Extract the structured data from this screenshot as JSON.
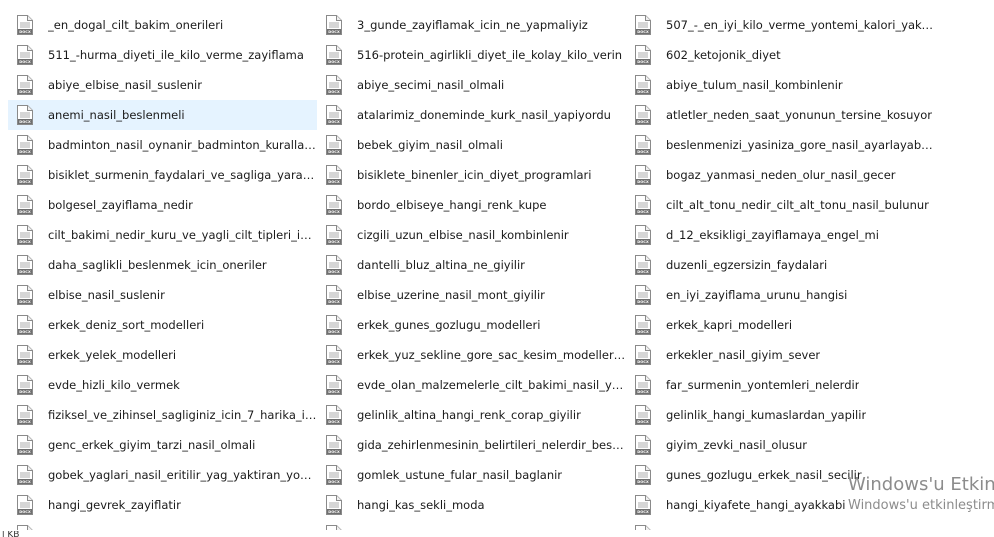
{
  "columns": [
    {
      "items": [
        {
          "name": "_en_dogal_cilt_bakim_onerileri",
          "icon": "docx-file-icon"
        },
        {
          "name": "511_-hurma_diyeti_ile_kilo_verme_zayiflama",
          "icon": "docx-file-icon"
        },
        {
          "name": "abiye_elbise_nasil_suslenir",
          "icon": "docx-file-icon"
        },
        {
          "name": "anemi_nasil_beslenmeli",
          "icon": "docx-file-icon",
          "selected": true
        },
        {
          "name": "badminton_nasil_oynanir_badminton_kurallari...",
          "icon": "docx-file-icon"
        },
        {
          "name": "bisiklet_surmenin_faydalari_ve_sagliga_yararlar...",
          "icon": "docx-file-icon"
        },
        {
          "name": "bolgesel_zayiflama_nedir",
          "icon": "docx-file-icon"
        },
        {
          "name": "cilt_bakimi_nedir_kuru_ve_yagli_cilt_tipleri_icin...",
          "icon": "docx-file-icon"
        },
        {
          "name": "daha_saglikli_beslenmek_icin_oneriler",
          "icon": "docx-file-icon"
        },
        {
          "name": "elbise_nasil_suslenir",
          "icon": "docx-file-icon"
        },
        {
          "name": "erkek_deniz_sort_modelleri",
          "icon": "docx-file-icon"
        },
        {
          "name": "erkek_yelek_modelleri",
          "icon": "docx-file-icon"
        },
        {
          "name": "evde_hizli_kilo_vermek",
          "icon": "docx-file-icon"
        },
        {
          "name": "fiziksel_ve_zihinsel_sagliginiz_icin_7_harika_ipu...",
          "icon": "docx-file-icon"
        },
        {
          "name": "genc_erkek_giyim_tarzi_nasil_olmali",
          "icon": "docx-file-icon"
        },
        {
          "name": "gobek_yaglari_nasil_eritilir_yag_yaktiran_yonte...",
          "icon": "docx-file-icon"
        },
        {
          "name": "hangi_gevrek_zayiflatir",
          "icon": "docx-file-icon"
        },
        {
          "name": "",
          "icon": "docx-file-icon"
        }
      ]
    },
    {
      "items": [
        {
          "name": "3_gunde_zayiflamak_icin_ne_yapmaliyiz",
          "icon": "docx-file-icon"
        },
        {
          "name": "516-protein_agirlikli_diyet_ile_kolay_kilo_verin",
          "icon": "docx-file-icon"
        },
        {
          "name": "abiye_secimi_nasil_olmali",
          "icon": "docx-file-icon"
        },
        {
          "name": "atalarimiz_doneminde_kurk_nasil_yapiyordu",
          "icon": "docx-file-icon"
        },
        {
          "name": "bebek_giyim_nasil_olmali",
          "icon": "docx-file-icon"
        },
        {
          "name": "bisiklete_binenler_icin_diyet_programlari",
          "icon": "docx-file-icon"
        },
        {
          "name": "bordo_elbiseye_hangi_renk_kupe",
          "icon": "docx-file-icon"
        },
        {
          "name": "cizgili_uzun_elbise_nasil_kombinlenir",
          "icon": "docx-file-icon"
        },
        {
          "name": "dantelli_bluz_altina_ne_giyilir",
          "icon": "docx-file-icon"
        },
        {
          "name": "elbise_uzerine_nasil_mont_giyilir",
          "icon": "docx-file-icon"
        },
        {
          "name": "erkek_gunes_gozlugu_modelleri",
          "icon": "docx-file-icon"
        },
        {
          "name": "erkek_yuz_sekline_gore_sac_kesim_modelleri_n...",
          "icon": "docx-file-icon"
        },
        {
          "name": "evde_olan_malzemelerle_cilt_bakimi_nasil_yapilir",
          "icon": "docx-file-icon"
        },
        {
          "name": "gelinlik_altina_hangi_renk_corap_giyilir",
          "icon": "docx-file-icon"
        },
        {
          "name": "gida_zehirlenmesinin_belirtileri_nelerdir_besin_...",
          "icon": "docx-file-icon"
        },
        {
          "name": "gomlek_ustune_fular_nasil_baglanir",
          "icon": "docx-file-icon"
        },
        {
          "name": "hangi_kas_sekli_moda",
          "icon": "docx-file-icon"
        },
        {
          "name": "",
          "icon": "docx-file-icon"
        }
      ]
    },
    {
      "items": [
        {
          "name": "507_-_en_iyi_kilo_verme_yontemi_kalori_yakan...",
          "icon": "docx-file-icon"
        },
        {
          "name": "602_ketojonik_diyet",
          "icon": "docx-file-icon"
        },
        {
          "name": "abiye_tulum_nasil_kombinlenir",
          "icon": "docx-file-icon"
        },
        {
          "name": "atletler_neden_saat_yonunun_tersine_kosuyor",
          "icon": "docx-file-icon"
        },
        {
          "name": "beslenmenizi_yasiniza_gore_nasil_ayarlayabilirs...",
          "icon": "docx-file-icon"
        },
        {
          "name": "bogaz_yanmasi_neden_olur_nasil_gecer",
          "icon": "docx-file-icon"
        },
        {
          "name": "cilt_alt_tonu_nedir_cilt_alt_tonu_nasil_bulunur",
          "icon": "docx-file-icon"
        },
        {
          "name": "d_12_eksikligi_zayiflamaya_engel_mi",
          "icon": "docx-file-icon"
        },
        {
          "name": "duzenli_egzersizin_faydalari",
          "icon": "docx-file-icon"
        },
        {
          "name": "en_iyi_zayiflama_urunu_hangisi",
          "icon": "docx-file-icon"
        },
        {
          "name": "erkek_kapri_modelleri",
          "icon": "docx-file-icon"
        },
        {
          "name": "erkekler_nasil_giyim_sever",
          "icon": "docx-file-icon"
        },
        {
          "name": "far_surmenin_yontemleri_nelerdir",
          "icon": "docx-file-icon"
        },
        {
          "name": "gelinlik_hangi_kumaslardan_yapilir",
          "icon": "docx-file-icon"
        },
        {
          "name": "giyim_zevki_nasil_olusur",
          "icon": "docx-file-icon"
        },
        {
          "name": "gunes_gozlugu_erkek_nasil_secilir",
          "icon": "docx-file-icon"
        },
        {
          "name": "hangi_kiyafete_hangi_ayakkabi",
          "icon": "docx-file-icon"
        },
        {
          "name": "",
          "icon": "docx-file-icon"
        }
      ]
    }
  ],
  "icon_label": "DOCX",
  "colors": {
    "selection": "#e5f3ff",
    "icon_badge": "#6f6f6f",
    "icon_line": "#9a9a9a",
    "icon_border": "#8a8a8a",
    "watermark": "#8c8c8c"
  },
  "watermark": {
    "title": "Windows'u Etkin",
    "subtitle": "Windows'u etkinleştirm"
  },
  "status_fragment": "l KB"
}
